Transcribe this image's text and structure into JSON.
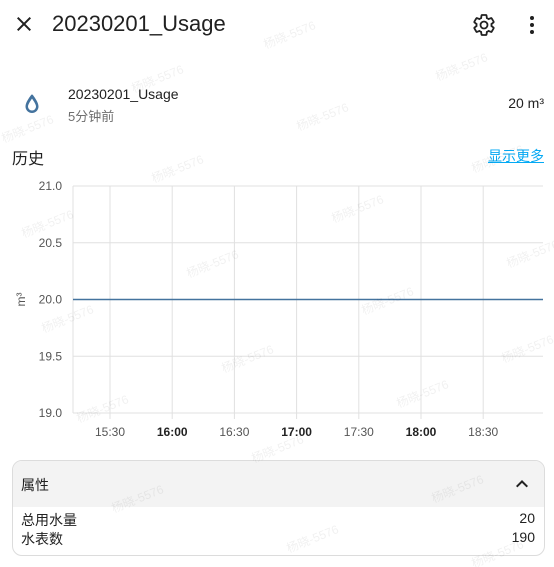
{
  "header": {
    "title": "20230201_Usage",
    "close_icon": "close-icon",
    "settings_icon": "gear-icon",
    "more_icon": "more-vertical-icon"
  },
  "entity": {
    "icon": "water-drop-icon",
    "icon_color": "#44739e",
    "name": "20230201_Usage",
    "time": "5分钟前",
    "value": "20 m³"
  },
  "history": {
    "label": "历史",
    "show_more": "显示更多",
    "link_color": "#03a9f4"
  },
  "chart_data": {
    "type": "line",
    "ylabel": "m³",
    "ylim": [
      19.0,
      21.0
    ],
    "y_ticks": [
      "21.0",
      "20.5",
      "20.0",
      "19.5",
      "19.0"
    ],
    "x_ticks": [
      {
        "label": "15:30",
        "bold": false
      },
      {
        "label": "16:00",
        "bold": true
      },
      {
        "label": "16:30",
        "bold": false
      },
      {
        "label": "17:00",
        "bold": true
      },
      {
        "label": "17:30",
        "bold": false
      },
      {
        "label": "18:00",
        "bold": true
      },
      {
        "label": "18:30",
        "bold": false
      }
    ],
    "series": [
      {
        "values": [
          20,
          20,
          20,
          20,
          20,
          20,
          20
        ],
        "color": "#44739e"
      }
    ],
    "grid": true
  },
  "attributes": {
    "title": "属性",
    "expanded": true,
    "rows": [
      {
        "key": "总用水量",
        "value": "20"
      },
      {
        "key": "水表数",
        "value": "190"
      }
    ]
  },
  "watermark": "杨晓-5576"
}
